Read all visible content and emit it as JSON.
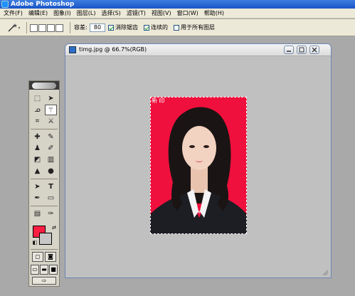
{
  "app": {
    "title": "Adobe Photoshop"
  },
  "menu": [
    "文件(F)",
    "编辑(E)",
    "图象(I)",
    "图层(L)",
    "选择(S)",
    "滤镜(T)",
    "视图(V)",
    "窗口(W)",
    "帮助(H)"
  ],
  "options": {
    "tolerance_label": "容差:",
    "tolerance_value": "80",
    "anti_alias_label": "消除锯齿",
    "contiguous_label": "连续的",
    "all_layers_label": "用于所有图层",
    "anti_alias_checked": true,
    "contiguous_checked": true,
    "all_layers_checked": false
  },
  "document": {
    "title": "timg.jpg @ 66.7%(RGB)",
    "watermark": "新 印"
  },
  "colors": {
    "foreground": "#ff1e42",
    "background": "#c7c7c7",
    "photo_background": "#f0103d"
  },
  "toolbox": {
    "tools": [
      "rectangular-marquee",
      "move",
      "lasso",
      "magic-wand",
      "crop",
      "slice",
      "healing-brush",
      "brush",
      "clone-stamp",
      "history-brush",
      "eraser",
      "gradient",
      "blur",
      "dodge",
      "path-selection",
      "type",
      "pen",
      "shape",
      "notes",
      "eyedropper",
      "hand",
      "zoom"
    ],
    "active_tool": "magic-wand"
  }
}
